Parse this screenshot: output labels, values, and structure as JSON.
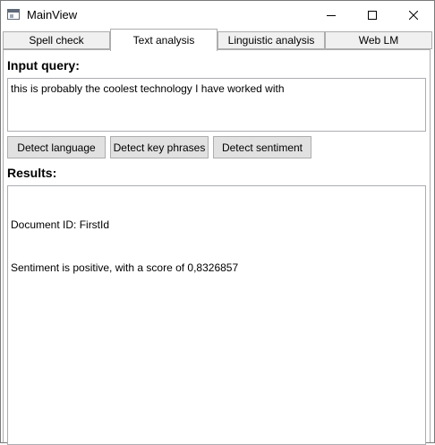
{
  "window": {
    "title": "MainView",
    "icon": "window-app-icon",
    "controls": [
      "minimize-icon",
      "maximize-icon",
      "close-icon"
    ]
  },
  "tabs": [
    {
      "label": "Spell check"
    },
    {
      "label": "Text analysis",
      "active": true
    },
    {
      "label": "Linguistic analysis"
    },
    {
      "label": "Web LM"
    }
  ],
  "input": {
    "heading": "Input query:",
    "value": "this is probably the coolest technology I have worked with"
  },
  "buttons": {
    "detect_language": "Detect language",
    "detect_key_phrases": "Detect key phrases",
    "detect_sentiment": "Detect sentiment"
  },
  "results": {
    "heading": "Results:",
    "lines": [
      "Document ID: FirstId",
      "Sentiment is positive, with a score of 0,8326857"
    ]
  }
}
